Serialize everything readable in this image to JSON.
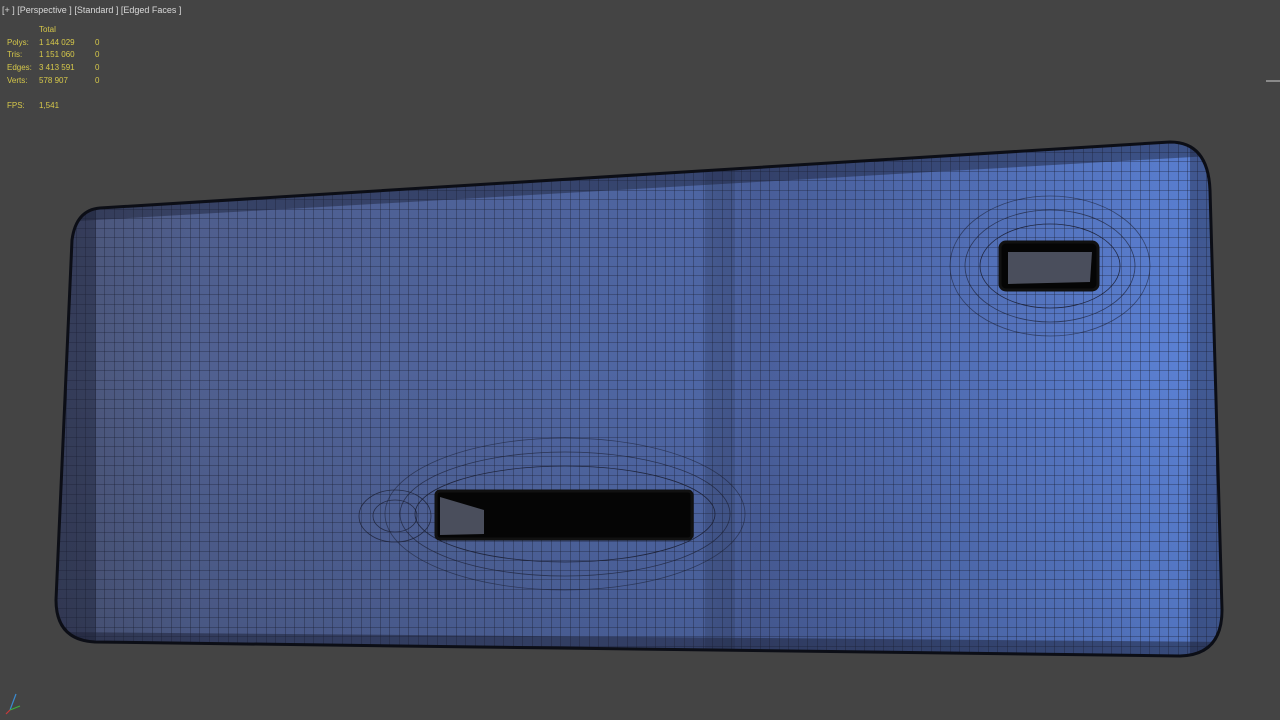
{
  "viewport": {
    "label_plus": "[+ ]",
    "label_view": "[Perspective ]",
    "label_shading": "[Standard ]",
    "label_edged": "[Edged Faces ]"
  },
  "stats": {
    "header": "Total",
    "rows": [
      {
        "name": "Polys:",
        "total": "1 144 029",
        "selected": "0"
      },
      {
        "name": "Tris:",
        "total": "1 151 060",
        "selected": "0"
      },
      {
        "name": "Edges:",
        "total": "3 413 591",
        "selected": "0"
      },
      {
        "name": "Verts:",
        "total": "578 907",
        "selected": "0"
      }
    ],
    "fps_label": "FPS:",
    "fps_value": "1,541"
  },
  "colors": {
    "background": "#444444",
    "mesh_light": "#5b7fd2",
    "mesh_dark": "#4a5a8a",
    "wire": "#1b1f33",
    "stats_text": "#d6c84a"
  },
  "icons": {
    "axis_gizmo": "xyz-axis-icon"
  }
}
